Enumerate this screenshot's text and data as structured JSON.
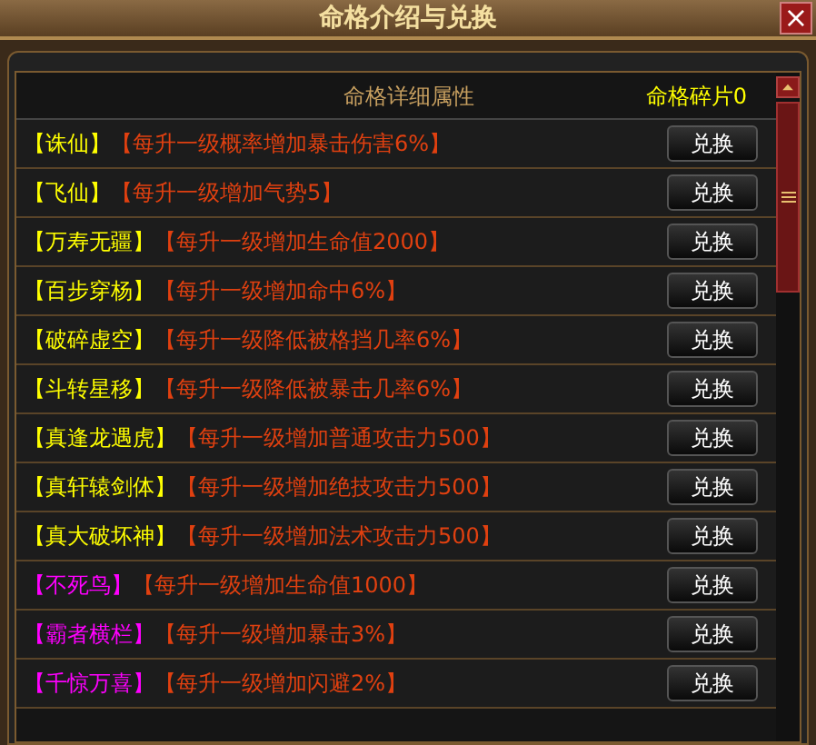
{
  "window": {
    "title": "命格介绍与兑换",
    "close": "×"
  },
  "header": {
    "column_label": "命格详细属性",
    "fragments": "命格碎片0"
  },
  "rows": [
    {
      "name": "【诛仙】",
      "color": "#ffff00",
      "desc": "【每升一级概率增加暴击伤害6%】",
      "button": "兑换"
    },
    {
      "name": "【飞仙】",
      "color": "#ffff00",
      "desc": "【每升一级增加气势5】",
      "button": "兑换"
    },
    {
      "name": "【万寿无疆】",
      "color": "#ffff00",
      "desc": "【每升一级增加生命值2000】",
      "button": "兑换"
    },
    {
      "name": "【百步穿杨】",
      "color": "#ffff00",
      "desc": "【每升一级增加命中6%】",
      "button": "兑换"
    },
    {
      "name": "【破碎虚空】",
      "color": "#ffff00",
      "desc": "【每升一级降低被格挡几率6%】",
      "button": "兑换"
    },
    {
      "name": "【斗转星移】",
      "color": "#ffff00",
      "desc": "【每升一级降低被暴击几率6%】",
      "button": "兑换"
    },
    {
      "name": "【真逢龙遇虎】",
      "color": "#ffff00",
      "desc": "【每升一级增加普通攻击力500】",
      "button": "兑换"
    },
    {
      "name": "【真轩辕剑体】",
      "color": "#ffff00",
      "desc": "【每升一级增加绝技攻击力500】",
      "button": "兑换"
    },
    {
      "name": "【真大破坏神】",
      "color": "#ffff00",
      "desc": "【每升一级增加法术攻击力500】",
      "button": "兑换"
    },
    {
      "name": "【不死鸟】",
      "color": "#ff00ff",
      "desc": "【每升一级增加生命值1000】",
      "button": "兑换"
    },
    {
      "name": "【霸者横栏】",
      "color": "#ff00ff",
      "desc": "【每升一级增加暴击3%】",
      "button": "兑换"
    },
    {
      "name": "【千惊万喜】",
      "color": "#ff00ff",
      "desc": "【每升一级增加闪避2%】",
      "button": "兑换"
    }
  ]
}
